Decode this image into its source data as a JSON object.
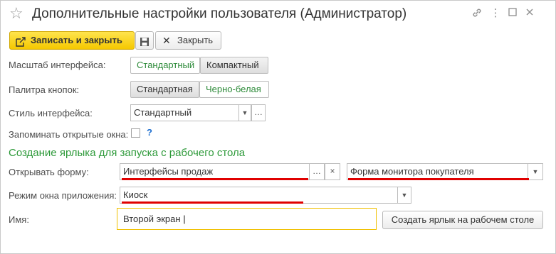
{
  "window": {
    "title": "Дополнительные настройки пользователя (Администратор)"
  },
  "toolbar": {
    "save_close_label": "Записать и закрыть",
    "close_label": "Закрыть"
  },
  "scale": {
    "label": "Масштаб интерфейса:",
    "options": [
      "Стандартный",
      "Компактный"
    ],
    "selected": "Стандартный"
  },
  "palette": {
    "label": "Палитра кнопок:",
    "options": [
      "Стандартная",
      "Черно-белая"
    ],
    "selected": "Черно-белая"
  },
  "style": {
    "label": "Стиль интерфейса:",
    "value": "Стандартный"
  },
  "remember": {
    "label": "Запоминать открытые окна:",
    "help": "?",
    "checked": false
  },
  "shortcut": {
    "heading": "Создание ярлыка для запуска с рабочего стола",
    "open_form_label": "Открывать форму:",
    "open_form_value": "Интерфейсы продаж",
    "form_value": "Форма монитора покупателя",
    "mode_label": "Режим окна приложения:",
    "mode_value": "Киоск",
    "name_label": "Имя:",
    "name_value": "Второй экран",
    "create_button": "Создать ярлык на рабочем столе"
  },
  "colors": {
    "accent_green": "#2e9a3a",
    "primary_yellow": "#f5c800",
    "highlight_red": "#e00000",
    "focus_border": "#f0c000"
  }
}
